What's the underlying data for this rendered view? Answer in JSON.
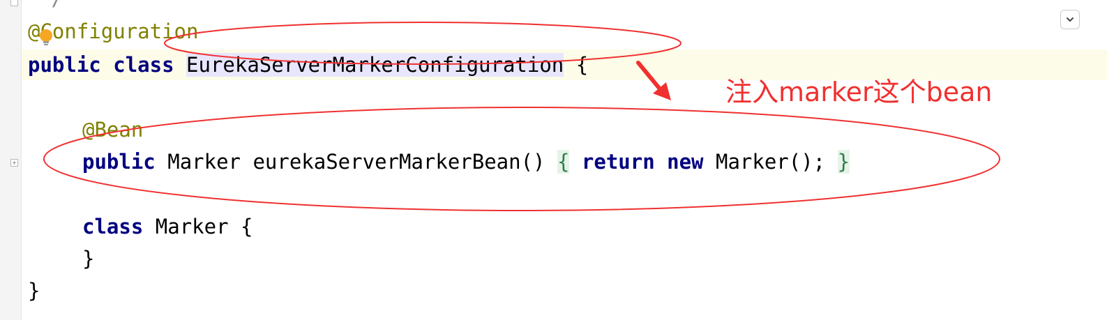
{
  "editor": {
    "partial_top_line": "*/",
    "lines": [
      {
        "annotation_prefix": "@",
        "annotation_rest": "Configuration"
      },
      {
        "kw_public": "public",
        "kw_class": "class",
        "class_name": "EurekaServerMarkerConfiguration",
        "brace": "{"
      },
      {
        "annotation": "@Bean"
      },
      {
        "kw_public": "public",
        "return_type": "Marker",
        "method_sig": "eurekaServerMarkerBean()",
        "open_brace": "{",
        "kw_return": "return",
        "kw_new": "new",
        "ctor_call": "Marker();",
        "close_brace": "}"
      },
      {
        "kw_class": "class",
        "class_name": "Marker",
        "brace": "{"
      },
      {
        "brace": "}"
      },
      {
        "brace": "}"
      }
    ]
  },
  "overlay": {
    "note": "注入marker这个bean",
    "note_color": "#f03030"
  },
  "icons": {
    "bulb": "lightbulb-icon",
    "dropdown": "chevron-down-icon"
  },
  "colors": {
    "keyword": "#000080",
    "annotation": "#808000",
    "identifier_highlight": "#e8e6fd",
    "caret_line": "#fdfce8",
    "brace_match": "#e7f3e7"
  }
}
